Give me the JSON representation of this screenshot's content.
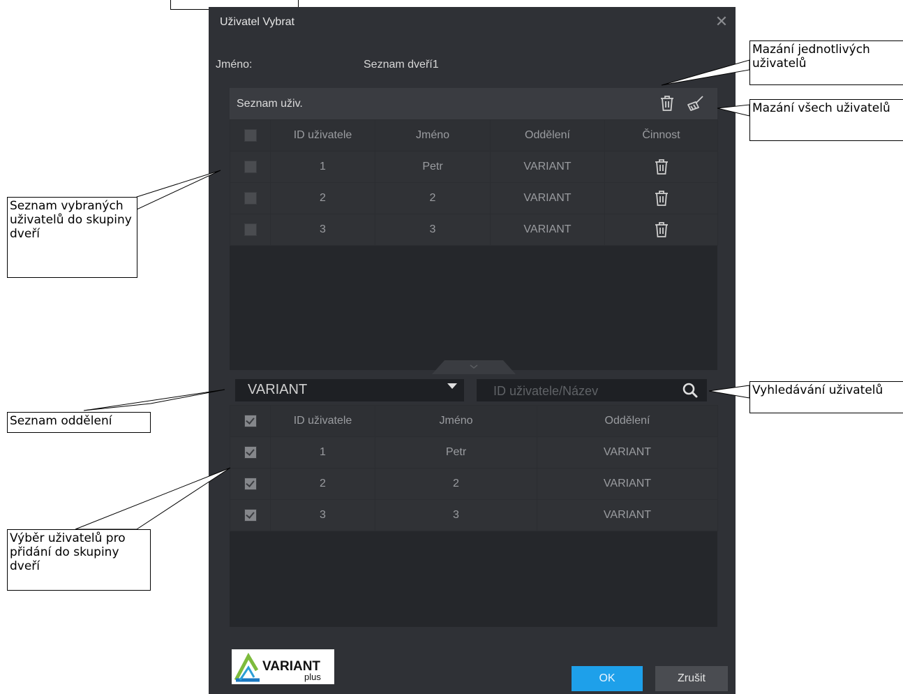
{
  "dialog": {
    "title": "Uživatel Vybrat",
    "close_symbol": "✕",
    "name_label": "Jméno:",
    "name_value": "Seznam dveří1"
  },
  "selected_users": {
    "title": "Seznam uživ.",
    "columns": [
      "ID uživatele",
      "Jméno",
      "Oddělení",
      "Činnost"
    ],
    "rows": [
      {
        "id": "1",
        "name": "Petr",
        "department": "VARIANT"
      },
      {
        "id": "2",
        "name": "2",
        "department": "VARIANT"
      },
      {
        "id": "3",
        "name": "3",
        "department": "VARIANT"
      }
    ]
  },
  "filter": {
    "department": "VARIANT",
    "search_placeholder": "ID uživatele/Název"
  },
  "available_users": {
    "columns": [
      "ID uživatele",
      "Jméno",
      "Oddělení"
    ],
    "rows": [
      {
        "id": "1",
        "name": "Petr",
        "department": "VARIANT",
        "checked": true
      },
      {
        "id": "2",
        "name": "2",
        "department": "VARIANT",
        "checked": true
      },
      {
        "id": "3",
        "name": "3",
        "department": "VARIANT",
        "checked": true
      }
    ]
  },
  "footer": {
    "logo_text": "VARIANT",
    "logo_sub": "plus",
    "ok_label": "OK",
    "cancel_label": "Zrušit"
  },
  "callouts": {
    "delete_single": "Mazání jednotlivých uživatelů",
    "delete_all": "Mazání všech uživatelů",
    "selected_list": "Seznam vybraných uživatelů do skupiny dveří",
    "department_list": "Seznam oddělení",
    "search_users": "Vyhledávání uživatelů",
    "select_to_add": "Výběr uživatelů pro přidání do skupiny dveří"
  },
  "colors": {
    "dialog_bg": "#2f3136",
    "panel_bg": "#25272b",
    "accent": "#1ea0ea"
  }
}
